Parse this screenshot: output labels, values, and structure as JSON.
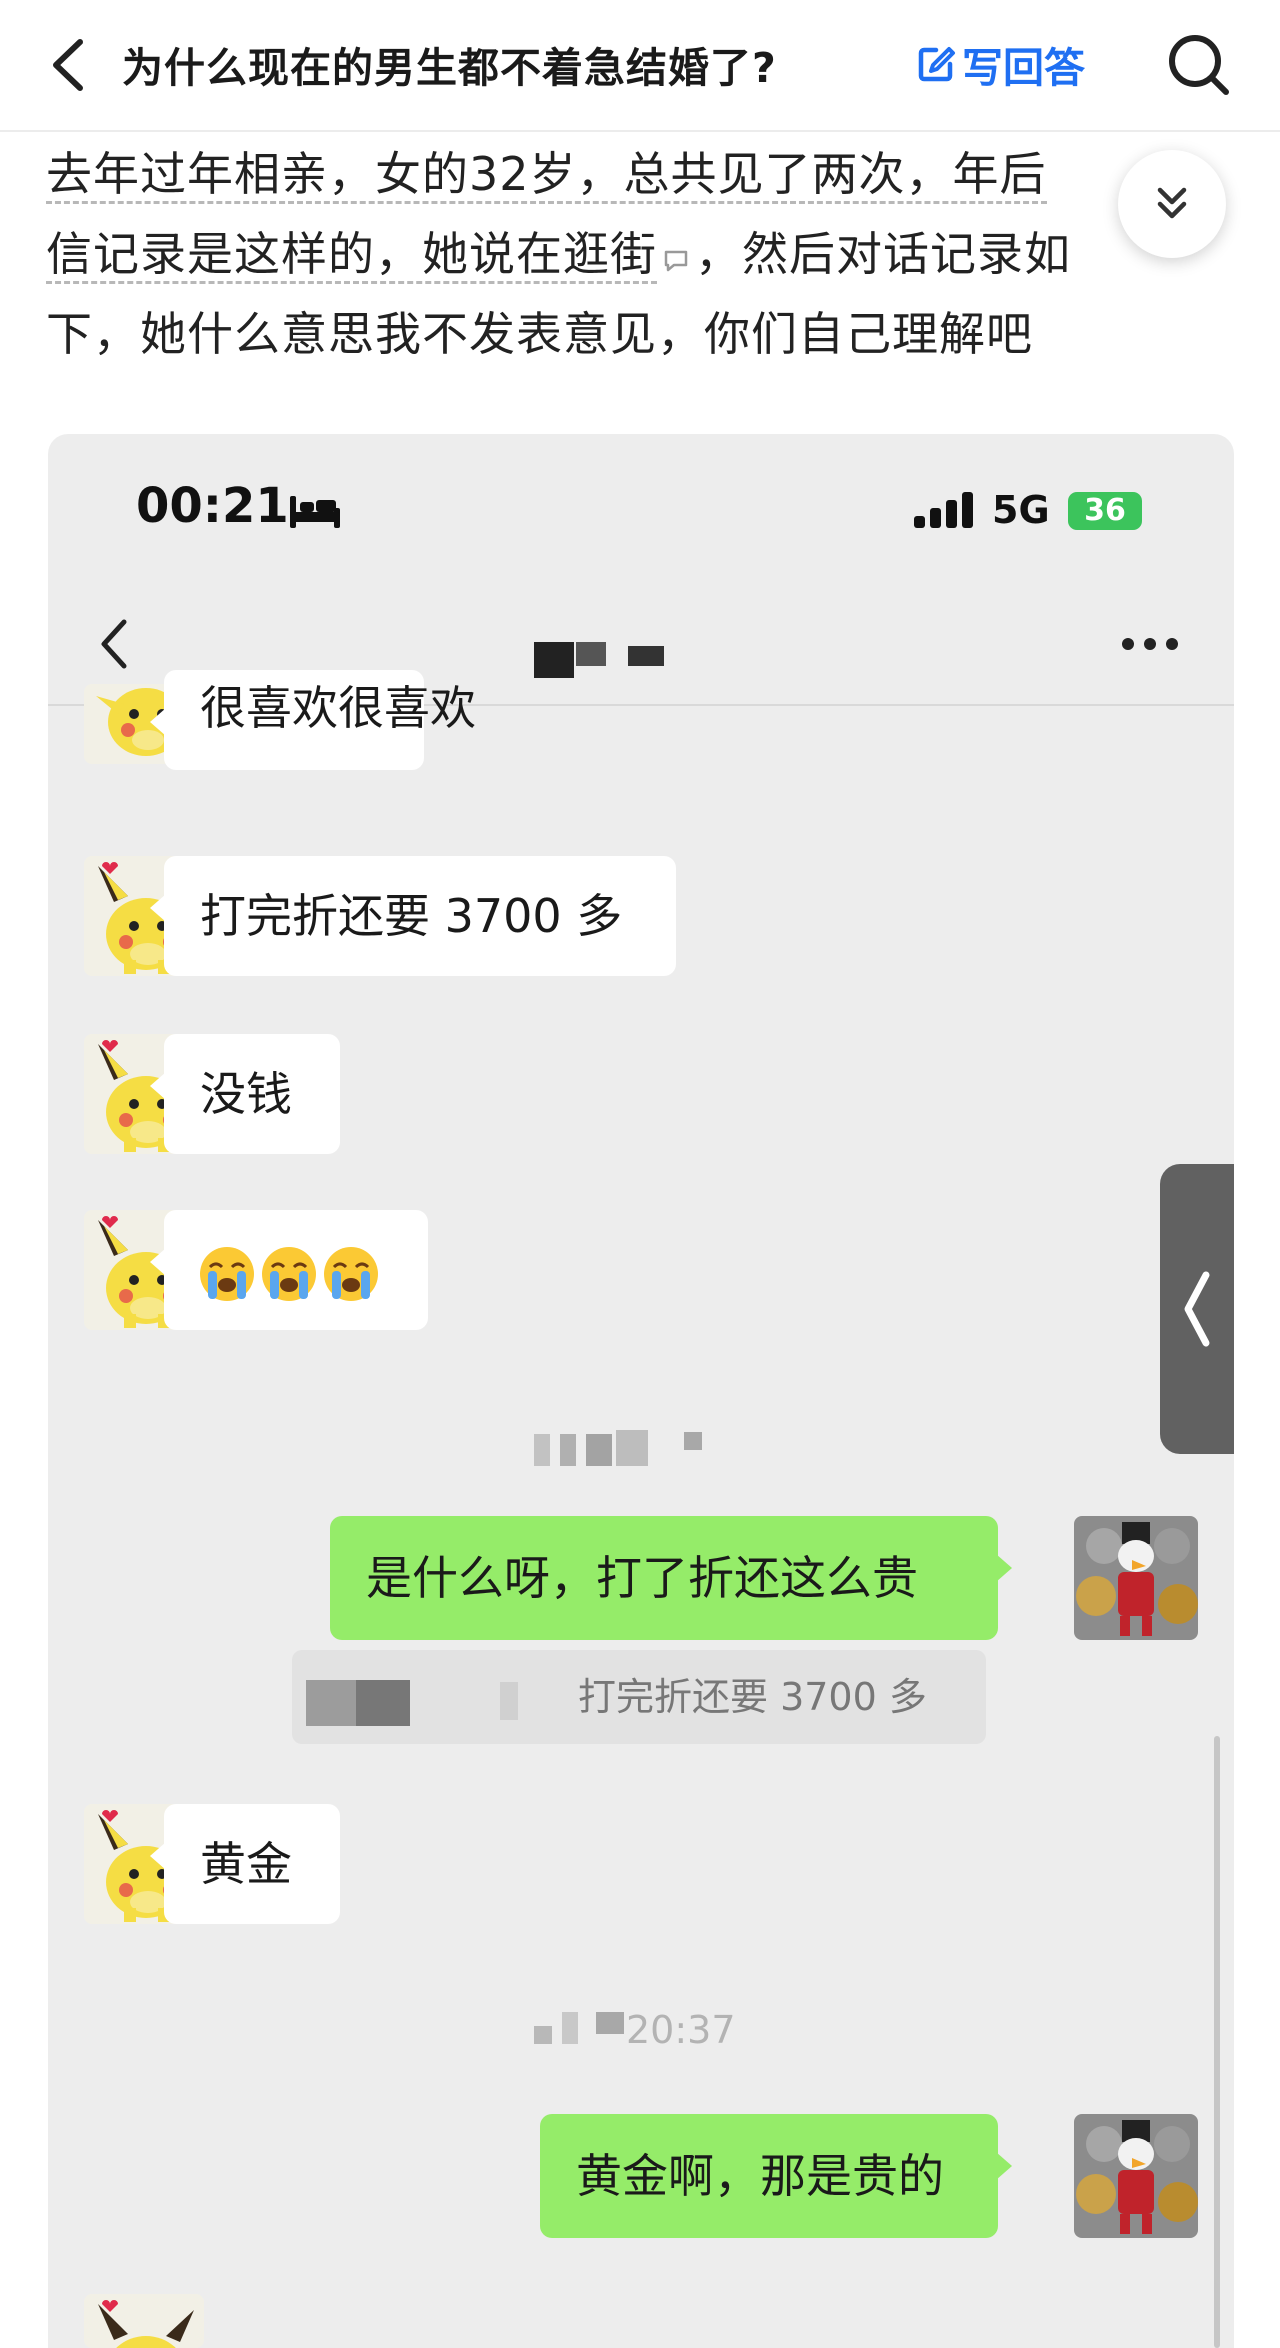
{
  "header": {
    "title": "为什么现在的男生都不着急结婚了?",
    "write_answer_label": "写回答",
    "icons": [
      "back-arrow-icon",
      "edit-icon",
      "search-icon"
    ]
  },
  "question_text": {
    "line1": "去年过年相亲，女的32岁，总共见了两次，年后",
    "line2_part1": "信记录是这样的，她说在逛街",
    "line2_part2": "，然后对话记录如",
    "line3": "下，她什么意思我不发表意见，你们自己理解吧"
  },
  "phone_status": {
    "time": "00:21",
    "network": "5G",
    "battery": "36"
  },
  "chat": {
    "messages": [
      {
        "from": "her",
        "text": "很喜欢很喜欢"
      },
      {
        "from": "her",
        "text": "打完折还要 3700 多"
      },
      {
        "from": "her",
        "text": "没钱"
      },
      {
        "from": "her",
        "text": "😭😭😭"
      },
      {
        "from": "me",
        "text": "是什么呀，打了折还这么贵"
      },
      {
        "from": "me_quote",
        "text": "打完折还要 3700 多"
      },
      {
        "from": "her",
        "text": "黄金"
      },
      {
        "from": "me",
        "text": "黄金啊，那是贵的"
      }
    ],
    "timestamp2": "20:37"
  },
  "colors": {
    "accent_blue": "#1f6ff2",
    "my_bubble": "#95ec69",
    "their_bubble": "#ffffff",
    "chat_bg": "#ededed"
  }
}
